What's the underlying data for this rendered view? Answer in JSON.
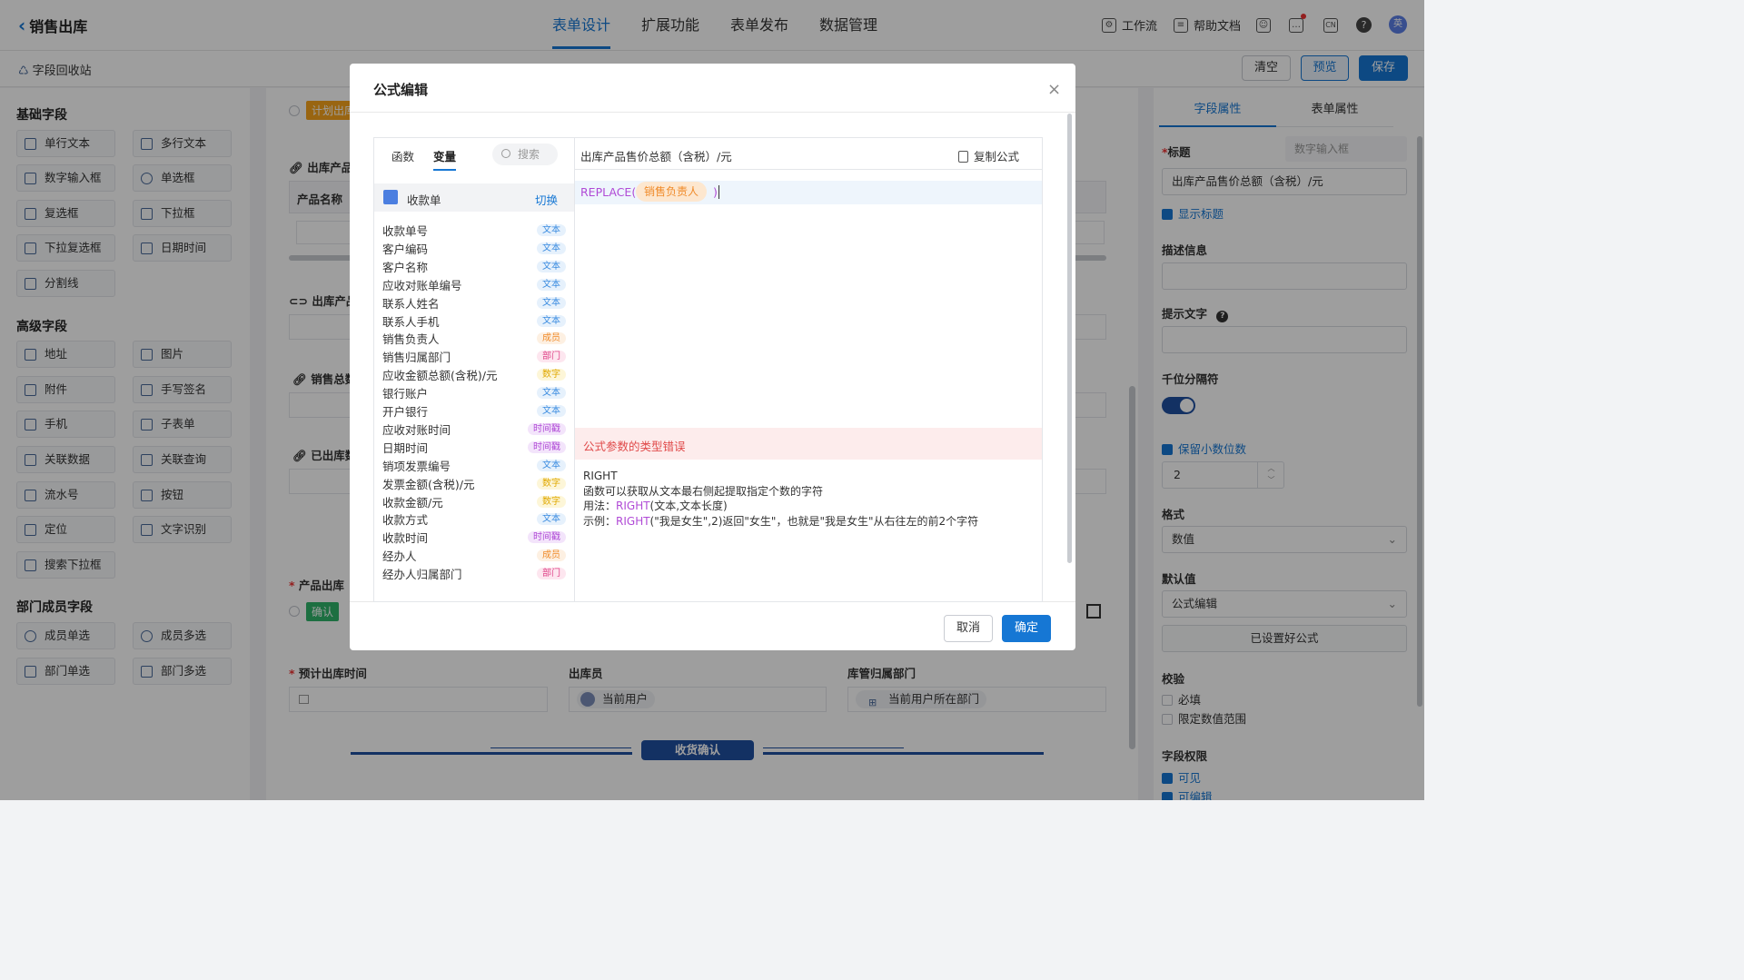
{
  "topbar": {
    "title": "销售出库",
    "tabs": [
      "表单设计",
      "扩展功能",
      "表单发布",
      "数据管理"
    ],
    "active_tab": 0,
    "workflow": "工作流",
    "help_docs": "帮助文档",
    "lang_icon_text": "CN",
    "avatar_text": "英"
  },
  "subbar": {
    "recycle": "字段回收站",
    "clear": "清空",
    "preview": "预览",
    "save": "保存"
  },
  "left": {
    "groups": [
      {
        "title": "基础字段",
        "items": [
          "单行文本",
          "多行文本",
          "数字输入框",
          "单选框",
          "复选框",
          "下拉框",
          "下拉复选框",
          "日期时间",
          "分割线"
        ]
      },
      {
        "title": "高级字段",
        "items": [
          "地址",
          "图片",
          "附件",
          "手写签名",
          "手机",
          "子表单",
          "关联数据",
          "关联查询",
          "流水号",
          "按钮",
          "定位",
          "文字识别",
          "搜索下拉框"
        ]
      },
      {
        "title": "部门成员字段",
        "items": [
          "成员单选",
          "成员多选",
          "部门单选",
          "部门多选"
        ]
      }
    ]
  },
  "center": {
    "plan_tag": "计划出库",
    "label_product_table": "出库产品明",
    "col_product_name": "产品名称",
    "label_link1": "出库产品",
    "label_sales_total": "销售总数",
    "label_shipped": "已出库数",
    "label_product_out": "产品出库",
    "confirm_tag": "确认",
    "label_expected_time": "预计出库时间",
    "label_operator": "出库员",
    "operator_value": "当前用户",
    "label_warehouse_dept": "库管归属部门",
    "warehouse_dept_value": "当前用户所在部门",
    "divider_text": "收货确认"
  },
  "right": {
    "tabs": [
      "字段属性",
      "表单属性"
    ],
    "title_label": "标题",
    "title_placeholder": "数字输入框",
    "title_value": "出库产品售价总额（含税）/元",
    "show_title": "显示标题",
    "desc_label": "描述信息",
    "hint_label": "提示文字",
    "thousand_label": "千位分隔符",
    "keep_decimal": "保留小数位数",
    "decimal_value": "2",
    "format_label": "格式",
    "format_value": "数值",
    "default_label": "默认值",
    "default_value": "公式编辑",
    "formula_set": "已设置好公式",
    "validate_label": "校验",
    "required": "必填",
    "limit_range": "限定数值范围",
    "perm_label": "字段权限",
    "visible": "可见",
    "editable": "可编辑"
  },
  "modal": {
    "title": "公式编辑",
    "tab_func": "函数",
    "tab_var": "变量",
    "search_placeholder": "搜索",
    "source_form": "收款单",
    "switch": "切换",
    "field_title": "出库产品售价总额（含税）/元",
    "copy_formula": "复制公式",
    "formula_func": "REPLACE(",
    "formula_token": "销售负责人",
    "formula_close": ")",
    "error": "公式参数的类型错误",
    "help_name": "RIGHT",
    "help_desc": "函数可以获取从文本最右侧起提取指定个数的字符",
    "help_usage_label": "用法：",
    "help_usage_func": "RIGHT",
    "help_usage_args": "(文本,文本长度)",
    "help_example_label": "示例：",
    "help_example_func": "RIGHT",
    "help_example_rest": "(\"我是女生\",2)返回\"女生\"，也就是\"我是女生\"从右往左的前2个字符",
    "cancel": "取消",
    "ok": "确定",
    "variables": [
      {
        "name": "收款单号",
        "type": "文本",
        "cls": "t-text"
      },
      {
        "name": "客户编码",
        "type": "文本",
        "cls": "t-text"
      },
      {
        "name": "客户名称",
        "type": "文本",
        "cls": "t-text"
      },
      {
        "name": "应收对账单编号",
        "type": "文本",
        "cls": "t-text"
      },
      {
        "name": "联系人姓名",
        "type": "文本",
        "cls": "t-text"
      },
      {
        "name": "联系人手机",
        "type": "文本",
        "cls": "t-text"
      },
      {
        "name": "销售负责人",
        "type": "成员",
        "cls": "t-mem"
      },
      {
        "name": "销售归属部门",
        "type": "部门",
        "cls": "t-dep"
      },
      {
        "name": "应收金额总额(含税)/元",
        "type": "数字",
        "cls": "t-num"
      },
      {
        "name": "银行账户",
        "type": "文本",
        "cls": "t-text"
      },
      {
        "name": "开户银行",
        "type": "文本",
        "cls": "t-text"
      },
      {
        "name": "应收对账时间",
        "type": "时间戳",
        "cls": "t-time"
      },
      {
        "name": "日期时间",
        "type": "时间戳",
        "cls": "t-time"
      },
      {
        "name": "销项发票编号",
        "type": "文本",
        "cls": "t-text"
      },
      {
        "name": "发票金额(含税)/元",
        "type": "数字",
        "cls": "t-num"
      },
      {
        "name": "收款金额/元",
        "type": "数字",
        "cls": "t-num"
      },
      {
        "name": "收款方式",
        "type": "文本",
        "cls": "t-text"
      },
      {
        "name": "收款时间",
        "type": "时间戳",
        "cls": "t-time"
      },
      {
        "name": "经办人",
        "type": "成员",
        "cls": "t-mem"
      },
      {
        "name": "经办人归属部门",
        "type": "部门",
        "cls": "t-dep"
      }
    ]
  }
}
